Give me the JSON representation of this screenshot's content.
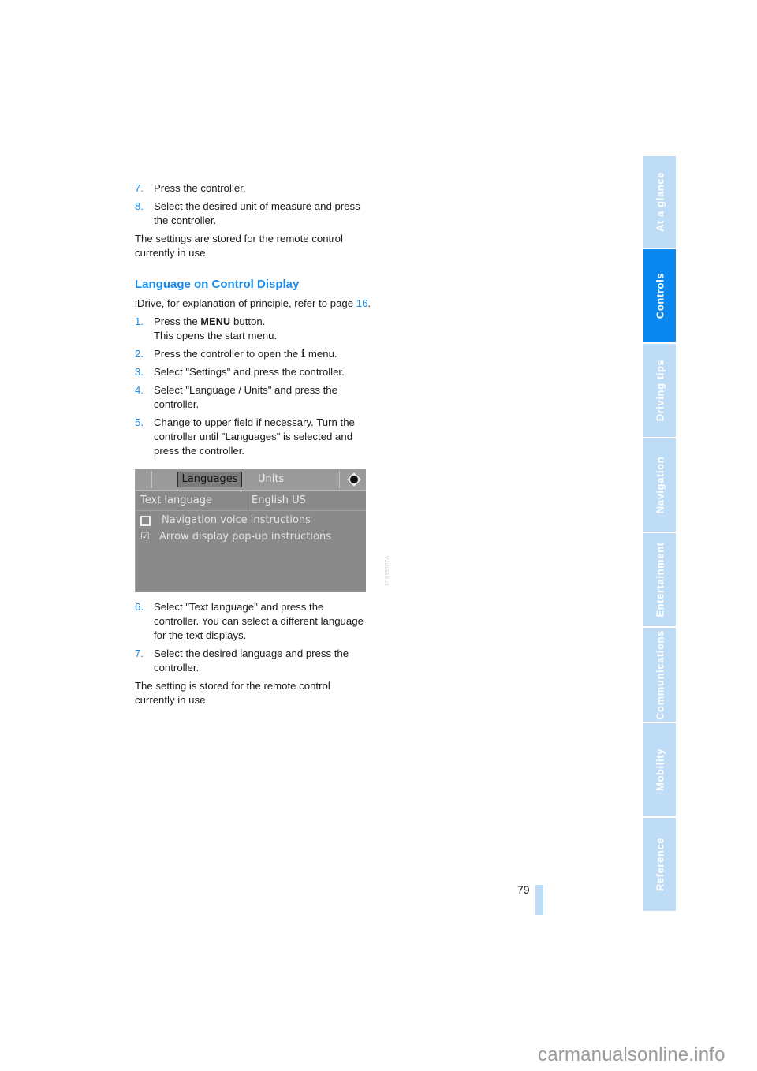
{
  "content": {
    "steps_top": [
      {
        "num": "7.",
        "text": "Press the controller."
      },
      {
        "num": "8.",
        "text": "Select the desired unit of measure and press the controller."
      }
    ],
    "para_top": "The settings are stored for the remote control currently in use.",
    "heading": "Language on Control Display",
    "intro_text": "iDrive, for explanation of principle, refer to page ",
    "intro_link": "16",
    "intro_end": ".",
    "steps_main": {
      "s1": {
        "num": "1.",
        "pre": "Press the ",
        "menu_word": "MENU",
        "post": " button.",
        "line2": "This opens the start menu."
      },
      "s2": {
        "num": "2.",
        "pre": "Press the controller to open the ",
        "glyph": "i",
        "post": " menu."
      },
      "s3": {
        "num": "3.",
        "text": "Select \"Settings\" and press the controller."
      },
      "s4": {
        "num": "4.",
        "text": "Select \"Language / Units\" and press the controller."
      },
      "s5": {
        "num": "5.",
        "text": "Change to upper field if necessary. Turn the controller until \"Languages\" is selected and press the controller."
      }
    },
    "screen": {
      "tab_active": "Languages",
      "tab_inactive": "Units",
      "nav_icon": "controller-icon",
      "text_language_label": "Text language",
      "text_language_value": "English US",
      "options": [
        {
          "icon": "checkbox-unchecked-icon",
          "label": "Navigation voice instructions",
          "checked": false
        },
        {
          "icon": "checkbox-checked-icon",
          "label": "Arrow display pop-up instructions",
          "checked": true
        }
      ],
      "image_code": "V2UL55BU3"
    },
    "steps_bottom": [
      {
        "num": "6.",
        "text": "Select \"Text language\" and press the controller. You can select a different language for the text displays."
      },
      {
        "num": "7.",
        "text": "Select the desired language and press the controller."
      }
    ],
    "para_bottom": "The setting is stored for the remote control currently in use."
  },
  "sidebar": {
    "tabs": [
      {
        "label": "At a glance",
        "active": false
      },
      {
        "label": "Controls",
        "active": true
      },
      {
        "label": "Driving tips",
        "active": false
      },
      {
        "label": "Navigation",
        "active": false
      },
      {
        "label": "Entertainment",
        "active": false
      },
      {
        "label": "Communications",
        "active": false
      },
      {
        "label": "Mobility",
        "active": false
      },
      {
        "label": "Reference",
        "active": false
      }
    ]
  },
  "page_number": "79",
  "watermark": "carmanualsonline.info",
  "colors": {
    "accent": "#1a8be8",
    "tab_active": "#0a88f0",
    "tab_inactive": "#bfdcf7"
  }
}
